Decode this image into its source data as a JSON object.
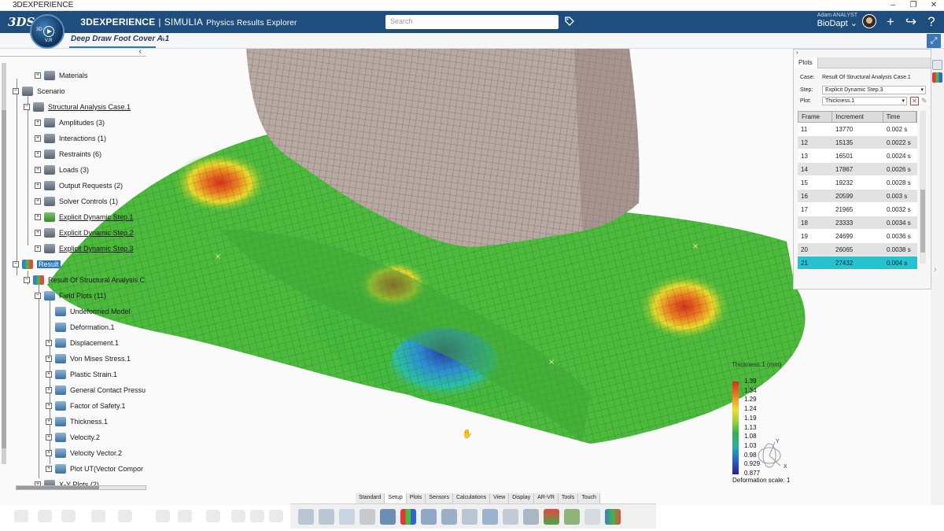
{
  "window": {
    "title": "3DEXPERIENCE",
    "controls": [
      "–",
      "❐",
      "✕"
    ]
  },
  "app": {
    "brand_bold": "3DEXPERIENCE",
    "brand_sep": "|",
    "brand_name": "SIMULIA",
    "brand_sub": "Physics Results Explorer",
    "compass_label": "3D",
    "compass_version": "V.R",
    "search_placeholder": "Search",
    "user_name": "Adam ANALYST",
    "workspace": "BioDapt ⌄",
    "icons": [
      "tag-icon",
      "add-icon",
      "share-icon",
      "help-icon"
    ]
  },
  "tab": {
    "label": "Deep Draw Foot Cover A.1",
    "plus": "+"
  },
  "tree": {
    "items": [
      {
        "label": "Materials",
        "indent": 3,
        "icon": "gray",
        "exp": "+"
      },
      {
        "label": "Scenario",
        "indent": 1,
        "icon": "gray",
        "exp": "−"
      },
      {
        "label": "Structural Analysis Case.1",
        "indent": 2,
        "icon": "gray",
        "exp": "−",
        "underline": true
      },
      {
        "label": "Amplitudes (3)",
        "indent": 3,
        "icon": "gray",
        "exp": "+"
      },
      {
        "label": "Interactions (1)",
        "indent": 3,
        "icon": "gray",
        "exp": "+"
      },
      {
        "label": "Restraints (6)",
        "indent": 3,
        "icon": "gray",
        "exp": "+"
      },
      {
        "label": "Loads (3)",
        "indent": 3,
        "icon": "gray",
        "exp": "+"
      },
      {
        "label": "Output Requests (2)",
        "indent": 3,
        "icon": "gray",
        "exp": "+"
      },
      {
        "label": "Solver Controls (1)",
        "indent": 3,
        "icon": "gray",
        "exp": "+"
      },
      {
        "label": "Explicit Dynamic Step.1",
        "indent": 3,
        "icon": "green",
        "exp": "+",
        "underline": true
      },
      {
        "label": "Explicit Dynamic Step.2",
        "indent": 3,
        "icon": "gray",
        "exp": "+",
        "underline": true
      },
      {
        "label": "Explicit Dynamic Step.3",
        "indent": 3,
        "icon": "gray",
        "exp": "+",
        "underline": true
      },
      {
        "label": "Result",
        "indent": 1,
        "icon": "multi",
        "exp": "−",
        "selected": true
      },
      {
        "label": "Result Of Structural Analysis C",
        "indent": 2,
        "icon": "multi",
        "exp": "−"
      },
      {
        "label": "Field Plots (11)",
        "indent": 3,
        "icon": "blue",
        "exp": "−"
      },
      {
        "label": "Undeformed Model",
        "indent": 4,
        "icon": "blue",
        "exp": ""
      },
      {
        "label": "Deformation.1",
        "indent": 4,
        "icon": "blue",
        "exp": ""
      },
      {
        "label": "Displacement.1",
        "indent": 4,
        "icon": "blue",
        "exp": "+"
      },
      {
        "label": "Von Mises Stress.1",
        "indent": 4,
        "icon": "blue",
        "exp": "+"
      },
      {
        "label": "Plastic Strain.1",
        "indent": 4,
        "icon": "blue",
        "exp": "+"
      },
      {
        "label": "General Contact Pressu",
        "indent": 4,
        "icon": "blue",
        "exp": "+"
      },
      {
        "label": "Factor of Safety.1",
        "indent": 4,
        "icon": "blue",
        "exp": "+"
      },
      {
        "label": "Thickness.1",
        "indent": 4,
        "icon": "blue",
        "exp": "+"
      },
      {
        "label": "Velocity.2",
        "indent": 4,
        "icon": "blue",
        "exp": "+"
      },
      {
        "label": "Velocity Vector.2",
        "indent": 4,
        "icon": "blue",
        "exp": "+"
      },
      {
        "label": "Plot UT(Vector Compor",
        "indent": 4,
        "icon": "blue",
        "exp": "+"
      },
      {
        "label": "X-Y Plots (2)",
        "indent": 3,
        "icon": "gray",
        "exp": "+"
      }
    ]
  },
  "plots": {
    "panel_tab": "Plots",
    "top_chevron": "›",
    "case_label": "Case:",
    "case_value": "Result Of Structural Analysis Case.1",
    "step_label": "Step:",
    "step_value": "Explicit Dynamic Step.3",
    "plot_label": "Plot:",
    "plot_value": "Thickness.1",
    "columns": [
      "Frame",
      "Increment",
      "Time"
    ],
    "rows": [
      {
        "frame": "11",
        "increment": "13770",
        "time": "0.002 s"
      },
      {
        "frame": "12",
        "increment": "15135",
        "time": "0.0022 s"
      },
      {
        "frame": "13",
        "increment": "16501",
        "time": "0.0024 s"
      },
      {
        "frame": "14",
        "increment": "17867",
        "time": "0.0026 s"
      },
      {
        "frame": "15",
        "increment": "19232",
        "time": "0.0028 s"
      },
      {
        "frame": "16",
        "increment": "20599",
        "time": "0.003 s"
      },
      {
        "frame": "17",
        "increment": "21965",
        "time": "0.0032 s"
      },
      {
        "frame": "18",
        "increment": "23333",
        "time": "0.0034 s"
      },
      {
        "frame": "19",
        "increment": "24699",
        "time": "0.0036 s"
      },
      {
        "frame": "20",
        "increment": "26065",
        "time": "0.0038 s"
      },
      {
        "frame": "21",
        "increment": "27432",
        "time": "0.004 s",
        "selected": true
      }
    ]
  },
  "legend": {
    "title": "Thickness.1 (mm)",
    "values": [
      "1.39",
      "1.34",
      "1.29",
      "1.24",
      "1.19",
      "1.13",
      "1.08",
      "1.03",
      "0.98",
      "0.929",
      "0.877"
    ],
    "deformation_scale": "Deformation scale: 1",
    "axis_x": "X",
    "axis_y": "Y"
  },
  "actionbar": {
    "tabs": [
      "Standard",
      "Setup",
      "Plots",
      "Sensors",
      "Calculations",
      "View",
      "Display",
      "AR-VR",
      "Tools",
      "Touch"
    ],
    "active_tab": "Setup"
  },
  "colors": {
    "header": "#1d4e7e",
    "selection": "#2a78c2",
    "row_selected": "#27c1d0"
  }
}
